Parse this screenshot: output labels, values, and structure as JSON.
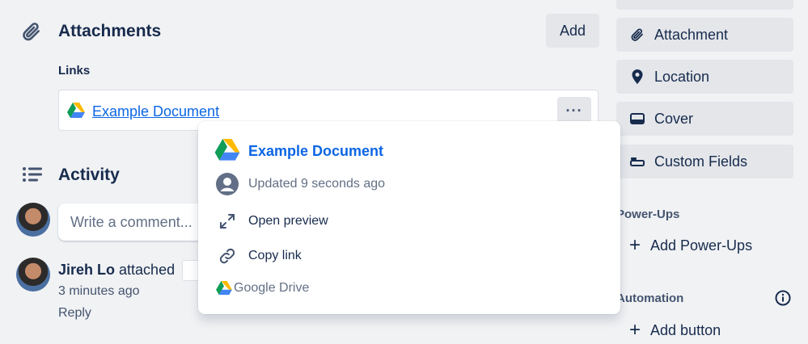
{
  "attachments": {
    "title": "Attachments",
    "add_label": "Add",
    "links_label": "Links",
    "link": {
      "title": "Example Document",
      "more_label": "···"
    }
  },
  "activity": {
    "title": "Activity",
    "comment_placeholder": "Write a comment...",
    "entry": {
      "author": "Jireh Lo",
      "action": "attached",
      "time": "3 minutes ago",
      "reply_label": "Reply"
    }
  },
  "popup": {
    "title": "Example Document",
    "updated": "Updated 9 seconds ago",
    "actions": [
      {
        "label": "Open preview",
        "icon": "expand-icon"
      },
      {
        "label": "Copy link",
        "icon": "link-icon"
      }
    ],
    "source": "Google Drive"
  },
  "sidebar": {
    "buttons": [
      {
        "label": "Attachment",
        "icon": "paperclip-icon"
      },
      {
        "label": "Location",
        "icon": "location-pin-icon"
      },
      {
        "label": "Cover",
        "icon": "cover-icon"
      },
      {
        "label": "Custom Fields",
        "icon": "custom-fields-icon"
      }
    ],
    "powerups_label": "Power-Ups",
    "add_powerups_label": "Add Power-Ups",
    "automation_label": "Automation",
    "add_button_label": "Add button"
  },
  "colors": {
    "background": "#f1f2f4",
    "button": "#e4e6ea",
    "link": "#0c66e4",
    "text": "#172b4d"
  }
}
